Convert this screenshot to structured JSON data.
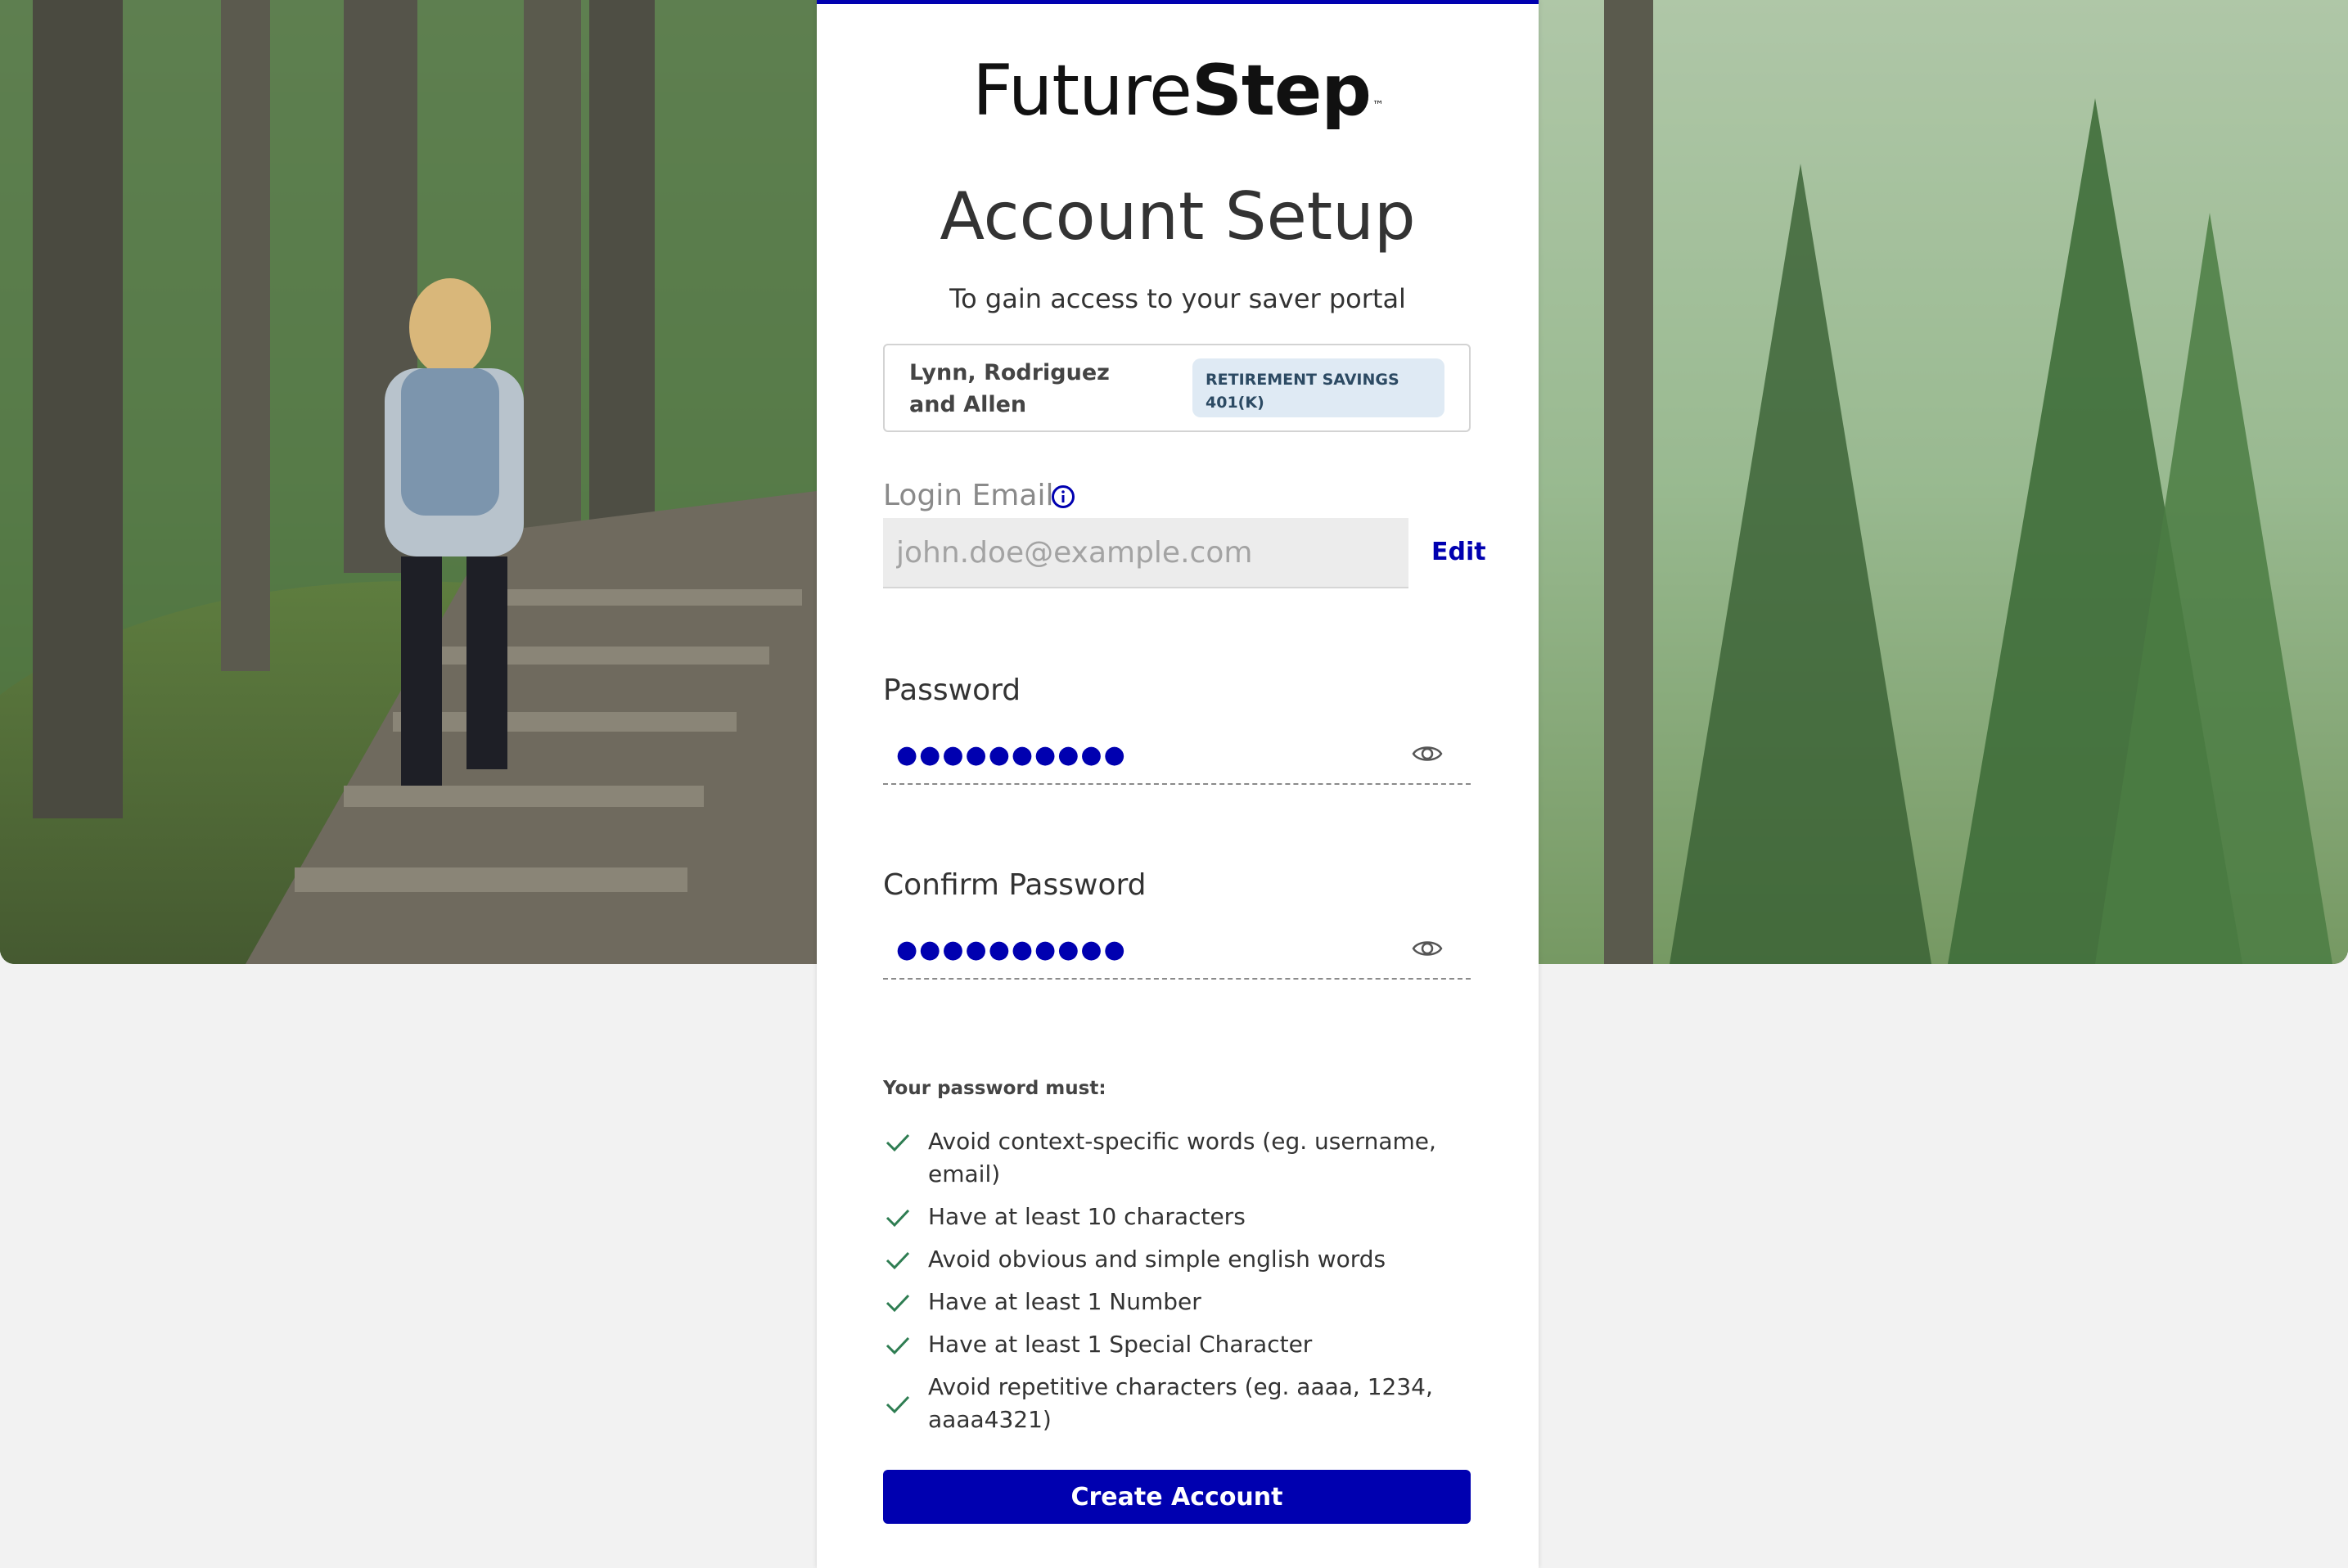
{
  "brand": {
    "logo_light": "Future",
    "logo_bold": "Step",
    "logo_tm": "™",
    "accent_color": "#0000b0"
  },
  "header": {
    "title": "Account Setup",
    "subtitle": "To gain access to your saver portal"
  },
  "plan": {
    "employer_name": "Lynn, Rodriguez and Allen",
    "badge": "RETIREMENT SAVINGS 401(K)"
  },
  "login_email": {
    "label": "Login Email",
    "placeholder": "john.doe@example.com",
    "edit_label": "Edit",
    "info_icon": "info-icon"
  },
  "password": {
    "label": "Password",
    "masked_value": "●●●●●●●●●●",
    "toggle_icon": "eye-icon"
  },
  "confirm_password": {
    "label": "Confirm Password",
    "masked_value": "●●●●●●●●●●",
    "toggle_icon": "eye-icon"
  },
  "requirements": {
    "title": "Your password must:",
    "items": [
      "Avoid context-specific words (eg. username, email)",
      "Have at least 10 characters",
      "Avoid obvious and simple english words",
      "Have at least 1 Number",
      "Have at least 1 Special Character",
      "Avoid repetitive characters (eg. aaaa, 1234, aaaa4321)"
    ],
    "check_color": "#2e7d52"
  },
  "submit": {
    "label": "Create Account"
  }
}
